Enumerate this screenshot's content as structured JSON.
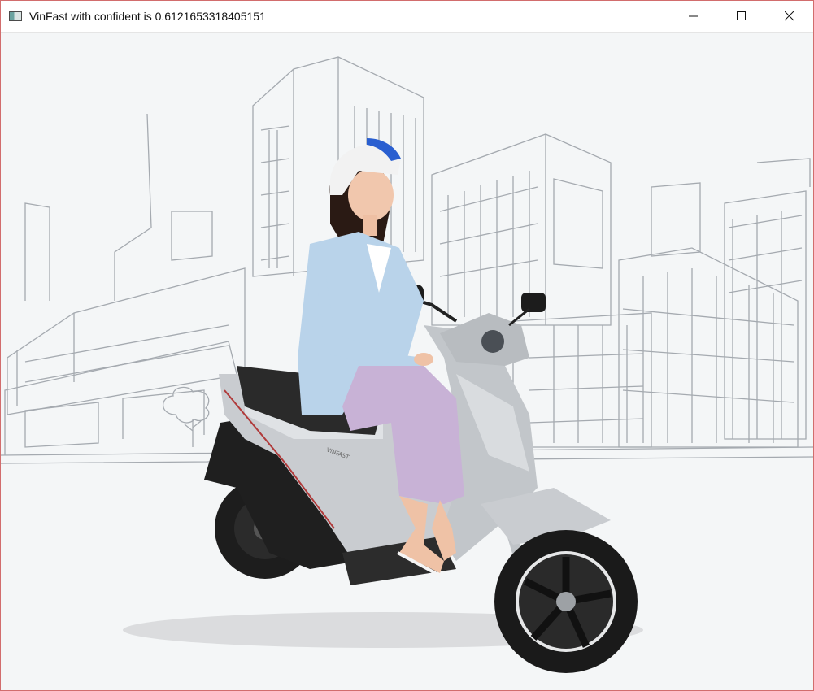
{
  "window": {
    "title": "VinFast with confident is 0.6121653318405151",
    "icon": "opencv-window-icon",
    "buttons": [
      {
        "name": "minimize-button",
        "icon": "minimize-icon"
      },
      {
        "name": "maximize-button",
        "icon": "maximize-icon"
      },
      {
        "name": "close-button",
        "icon": "close-icon"
      }
    ]
  },
  "image": {
    "description_text": "",
    "brand_text_on_scooter": "VINFAST",
    "colors": {
      "background": "#f4f6f7",
      "sketch_lines": "#9aa0a6",
      "scooter_body": "#c9ccd0",
      "blazer": "#b9d3ea",
      "trousers": "#c8b2d6",
      "helmet": "#f2f2f2",
      "helmet_stripe": "#2a5fd0",
      "tire": "#1a1a1a"
    }
  }
}
